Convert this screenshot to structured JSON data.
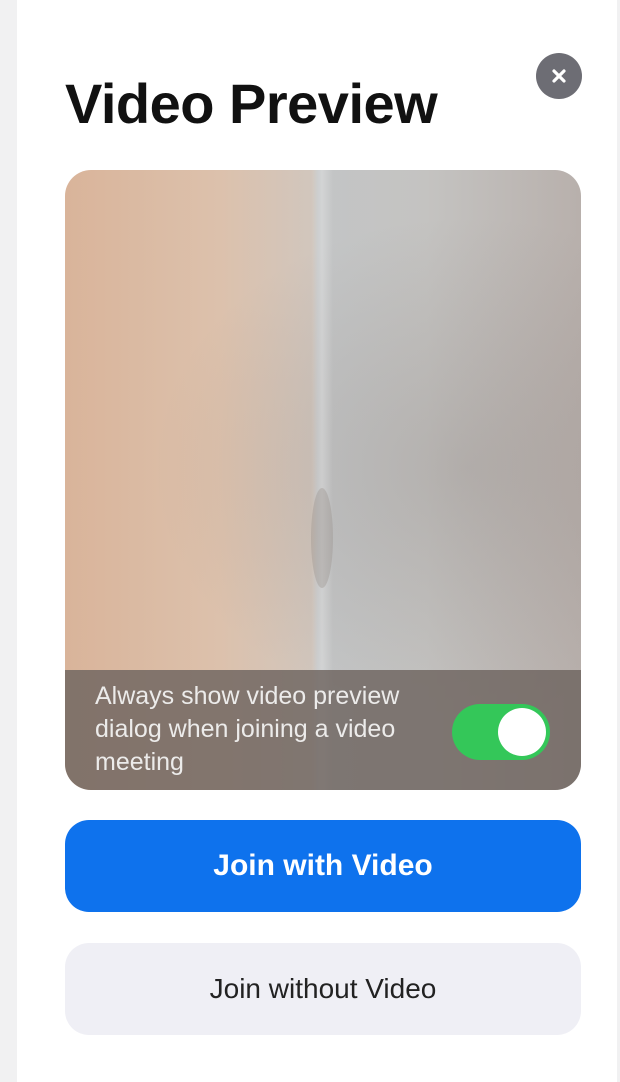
{
  "dialog": {
    "title": "Video Preview",
    "close_icon": "close-icon"
  },
  "preview": {
    "setting_text": "Always show video preview dialog when joining a video meeting",
    "toggle_on": true
  },
  "actions": {
    "join_with_video": "Join with Video",
    "join_without_video": "Join without Video"
  },
  "colors": {
    "primary": "#0e72ed",
    "toggle_on": "#34c759",
    "secondary_button": "#efeff5",
    "close_button": "#6d6d74"
  }
}
